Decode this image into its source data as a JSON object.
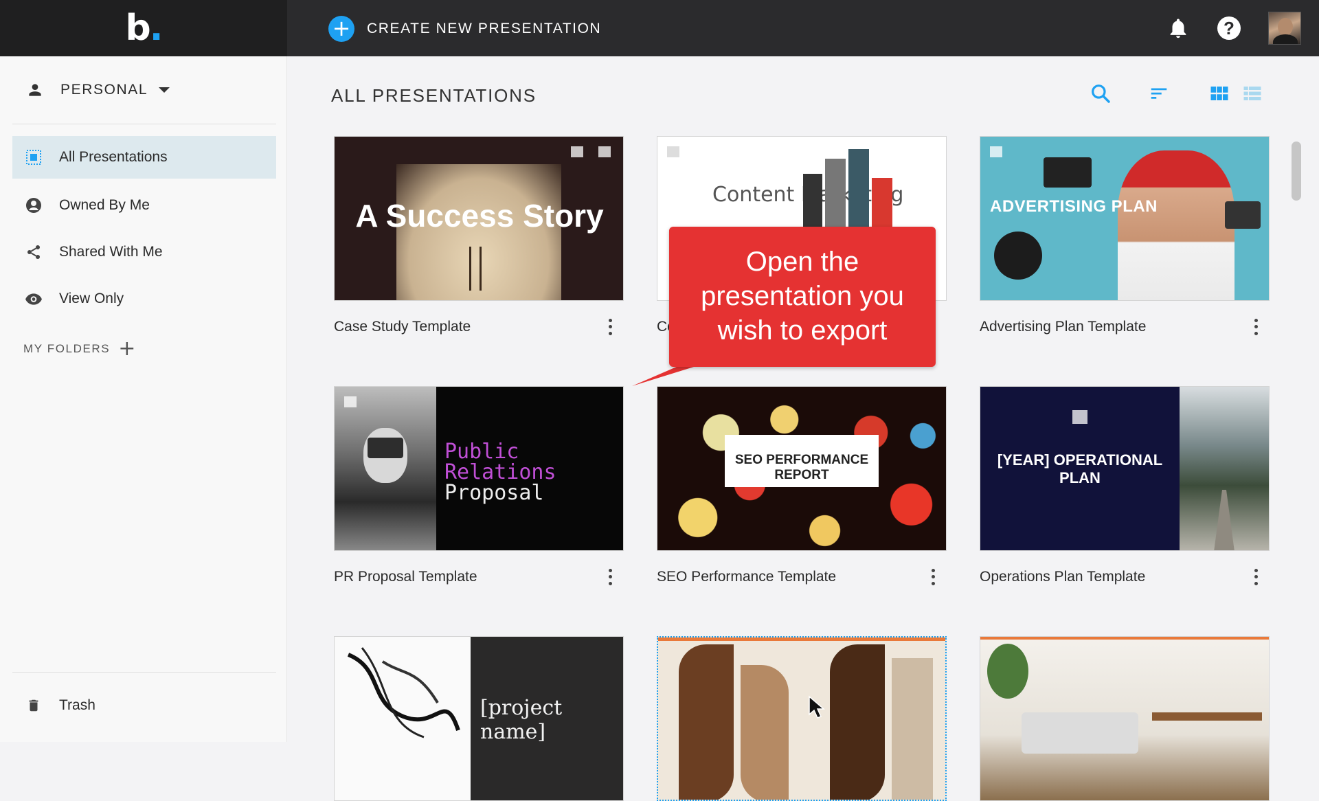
{
  "topbar": {
    "logo_text": "b",
    "create_label": "CREATE NEW PRESENTATION"
  },
  "sidebar": {
    "account_label": "PERSONAL",
    "items": [
      {
        "label": "All Presentations",
        "icon": "all-presentations-icon",
        "active": true
      },
      {
        "label": "Owned By Me",
        "icon": "account-circle-icon"
      },
      {
        "label": "Shared With Me",
        "icon": "share-icon"
      },
      {
        "label": "View Only",
        "icon": "eye-icon"
      }
    ],
    "folders_label": "MY FOLDERS",
    "trash_label": "Trash"
  },
  "main": {
    "title": "ALL PRESENTATIONS",
    "cards": [
      {
        "title": "Case Study Template",
        "thumb_text": "A Success Story"
      },
      {
        "title": "Co",
        "thumb_text": "Content Marketing"
      },
      {
        "title": "Advertising Plan Template",
        "thumb_text": "ADVERTISING PLAN"
      },
      {
        "title": "PR Proposal Template",
        "thumb_text_1": "Public",
        "thumb_text_2": "Relations",
        "thumb_text_3": "Proposal"
      },
      {
        "title": "SEO Performance Template",
        "thumb_text": "SEO PERFORMANCE REPORT"
      },
      {
        "title": "Operations Plan Template",
        "thumb_text": "[YEAR] OPERATIONAL PLAN"
      },
      {
        "title": "",
        "thumb_text": "[project name]"
      },
      {
        "title": ""
      },
      {
        "title": ""
      }
    ]
  },
  "callout": {
    "line1": "Open the",
    "line2": "presentation you",
    "line3": "wish to export"
  },
  "colors": {
    "accent": "#1ea1f2",
    "callout": "#e53232",
    "active_nav": "#dde9ee"
  }
}
